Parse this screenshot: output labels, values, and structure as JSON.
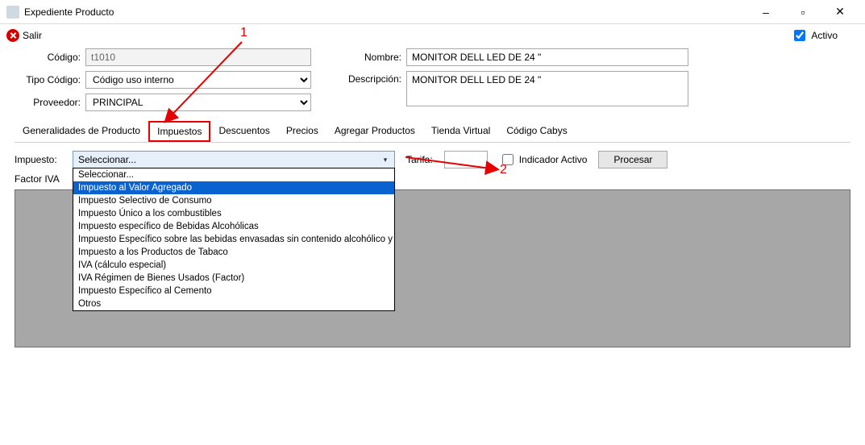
{
  "window": {
    "title": "Expediente Producto",
    "minimize": "–",
    "maximize": "▫",
    "close": "✕"
  },
  "toolbar": {
    "salir_label": "Salir",
    "activo_label": "Activo",
    "activo_checked": true
  },
  "form": {
    "codigo_label": "Código:",
    "codigo_value": "t1010",
    "tipo_codigo_label": "Tipo Código:",
    "tipo_codigo_value": "Código uso interno",
    "proveedor_label": "Proveedor:",
    "proveedor_value": "PRINCIPAL",
    "nombre_label": "Nombre:",
    "nombre_value": "MONITOR DELL LED DE 24 \"",
    "descripcion_label": "Descripción:",
    "descripcion_value": "MONITOR DELL LED DE 24 \""
  },
  "tabs": {
    "items": [
      "Generalidades de Producto",
      "Impuestos",
      "Descuentos",
      "Precios",
      "Agregar Productos",
      "Tienda Virtual",
      "Código Cabys"
    ],
    "active_index": 1
  },
  "impuestos": {
    "impuesto_label": "Impuesto:",
    "combo_value": "Seleccionar...",
    "options": [
      "Seleccionar...",
      "Impuesto al Valor Agregado",
      "Impuesto Selectivo de Consumo",
      "Impuesto Único a los combustibles",
      "Impuesto específico de Bebidas Alcohólicas",
      "Impuesto Específico sobre las bebidas envasadas sin contenido alcohólico y jabones",
      "Impuesto a los Productos de Tabaco",
      "IVA (cálculo especial)",
      "IVA Régimen de Bienes Usados (Factor)",
      "Impuesto Específico al Cemento",
      "Otros"
    ],
    "highlight_index": 1,
    "tarifa_label": "Tarifa:",
    "tarifa_value": "",
    "indicador_label": "Indicador Activo",
    "procesar_label": "Procesar",
    "factor_label": "Factor IVA"
  },
  "annotations": {
    "num1": "1",
    "num2": "2"
  }
}
